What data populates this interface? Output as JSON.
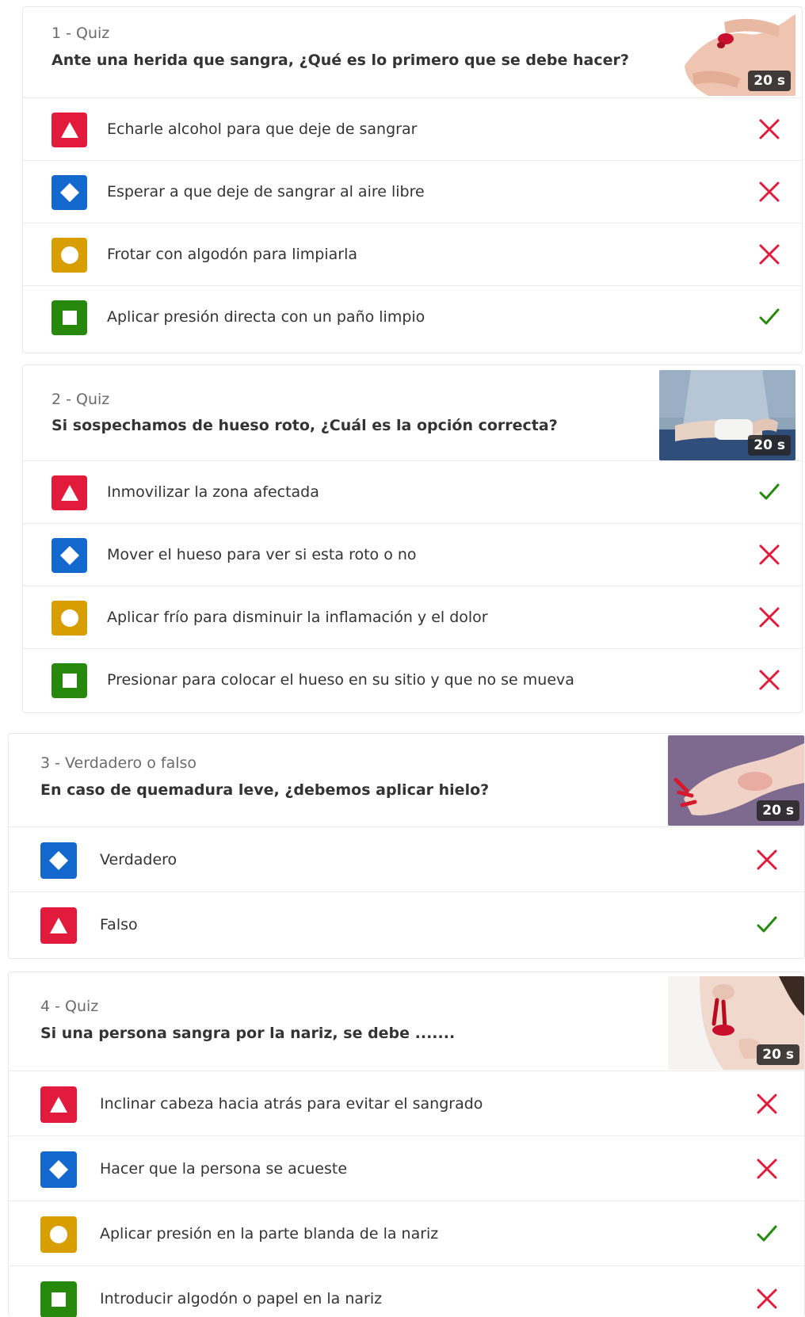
{
  "questions": [
    {
      "type_label": "1 - Quiz",
      "question": "Ante una herida que sangra, ¿Qué es lo primero que se debe hacer?",
      "time": "20 s",
      "image": "bleeding-finger-image",
      "options": [
        {
          "shape": "triangle",
          "color": "#e21b3c",
          "text": "Echarle alcohol para que deje de sangrar",
          "correct": false
        },
        {
          "shape": "diamond",
          "color": "#1368ce",
          "text": "Esperar a que deje de sangrar al aire libre",
          "correct": false
        },
        {
          "shape": "circle",
          "color": "#d89e00",
          "text": "Frotar con algodón para limpiarla",
          "correct": false
        },
        {
          "shape": "square",
          "color": "#26890c",
          "text": "Aplicar presión directa con un paño limpio",
          "correct": true
        }
      ]
    },
    {
      "type_label": "2 - Quiz",
      "question": "Si sospechamos de hueso roto, ¿Cuál es la opción correcta?",
      "time": "20 s",
      "image": "bandaged-wrist-image",
      "options": [
        {
          "shape": "triangle",
          "color": "#e21b3c",
          "text": "Inmovilizar la zona afectada",
          "correct": true
        },
        {
          "shape": "diamond",
          "color": "#1368ce",
          "text": "Mover el hueso para ver si esta roto o no",
          "correct": false
        },
        {
          "shape": "circle",
          "color": "#d89e00",
          "text": "Aplicar frío para disminuir la inflamación y el dolor",
          "correct": false
        },
        {
          "shape": "square",
          "color": "#26890c",
          "text": "Presionar para colocar el hueso en su sitio y que no se mueva",
          "correct": false
        }
      ]
    },
    {
      "type_label": "3 - Verdadero o falso",
      "question": "En caso de quemadura leve, ¿debemos aplicar hielo?",
      "time": "20 s",
      "image": "burned-arm-image",
      "options": [
        {
          "shape": "diamond",
          "color": "#1368ce",
          "text": "Verdadero",
          "correct": false
        },
        {
          "shape": "triangle",
          "color": "#e21b3c",
          "text": "Falso",
          "correct": true
        }
      ]
    },
    {
      "type_label": "4 - Quiz",
      "question": "Si una persona sangra por la nariz, se debe .......",
      "time": "20 s",
      "image": "nosebleed-image",
      "options": [
        {
          "shape": "triangle",
          "color": "#e21b3c",
          "text": "Inclinar cabeza hacia atrás para evitar el sangrado",
          "correct": false
        },
        {
          "shape": "diamond",
          "color": "#1368ce",
          "text": "Hacer que la persona se acueste",
          "correct": false
        },
        {
          "shape": "circle",
          "color": "#d89e00",
          "text": "Aplicar presión en la parte blanda de la nariz",
          "correct": true
        },
        {
          "shape": "square",
          "color": "#26890c",
          "text": "Introducir algodón o papel en la nariz",
          "correct": false
        }
      ]
    }
  ],
  "colors": {
    "correct": "#26890c",
    "incorrect": "#e21b3c"
  }
}
